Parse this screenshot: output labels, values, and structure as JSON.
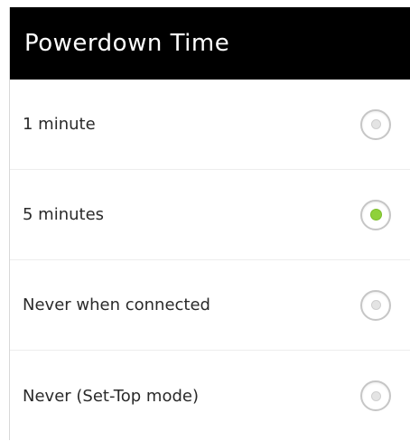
{
  "dialog": {
    "title": "Powerdown Time"
  },
  "options": [
    {
      "label": "1 minute",
      "selected": false
    },
    {
      "label": "5 minutes",
      "selected": true
    },
    {
      "label": "Never when connected",
      "selected": false
    },
    {
      "label": "Never (Set-Top mode)",
      "selected": false
    }
  ],
  "colors": {
    "title_background": "#000000",
    "title_text": "#ffffff",
    "selected_accent": "#8fd13a"
  }
}
